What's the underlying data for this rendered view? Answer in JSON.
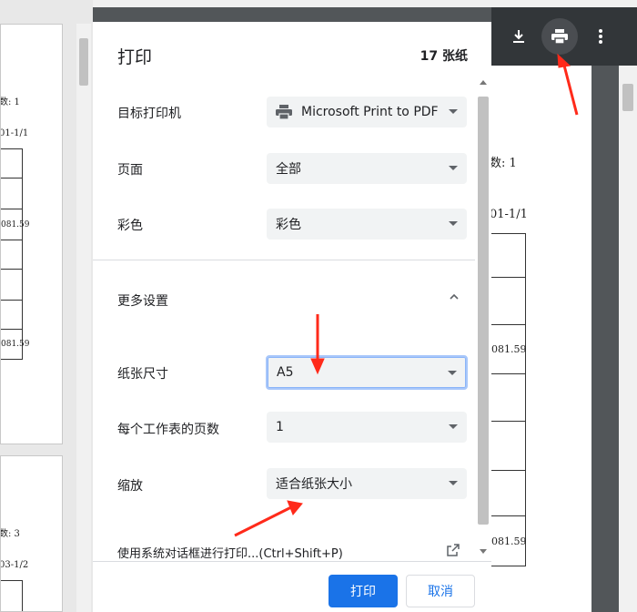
{
  "dialog": {
    "title": "打印",
    "sheet_count": "17 张纸",
    "rows": [
      {
        "label": "目标打印机",
        "value": "Microsoft Print to PDF"
      },
      {
        "label": "页面",
        "value": "全部"
      },
      {
        "label": "彩色",
        "value": "彩色"
      }
    ],
    "more_settings": "更多设置",
    "more_rows": [
      {
        "label": "纸张尺寸",
        "value": "A5"
      },
      {
        "label": "每个工作表的页数",
        "value": "1"
      },
      {
        "label": "缩放",
        "value": "适合纸张大小"
      }
    ],
    "system_dialog": "使用系统对话框进行打印...(Ctrl+Shift+P)",
    "print_button": "打印",
    "cancel_button": "取消"
  },
  "preview_left": {
    "page1": {
      "header": "数: 1",
      "date": "01-1/1",
      "value": "081.59",
      "value2": "081.59"
    },
    "page2": {
      "header": "数: 3",
      "date": "03-1/2"
    }
  },
  "preview_right": {
    "header": "数: 1",
    "date": "01-1/1",
    "value": "081.59",
    "value2": "081.59"
  },
  "viewer_toolbar": {
    "icons": [
      "download-icon",
      "print-icon",
      "more-vert-icon"
    ]
  },
  "colors": {
    "accent": "#1a73e8",
    "arrow": "#ff2a1a"
  }
}
